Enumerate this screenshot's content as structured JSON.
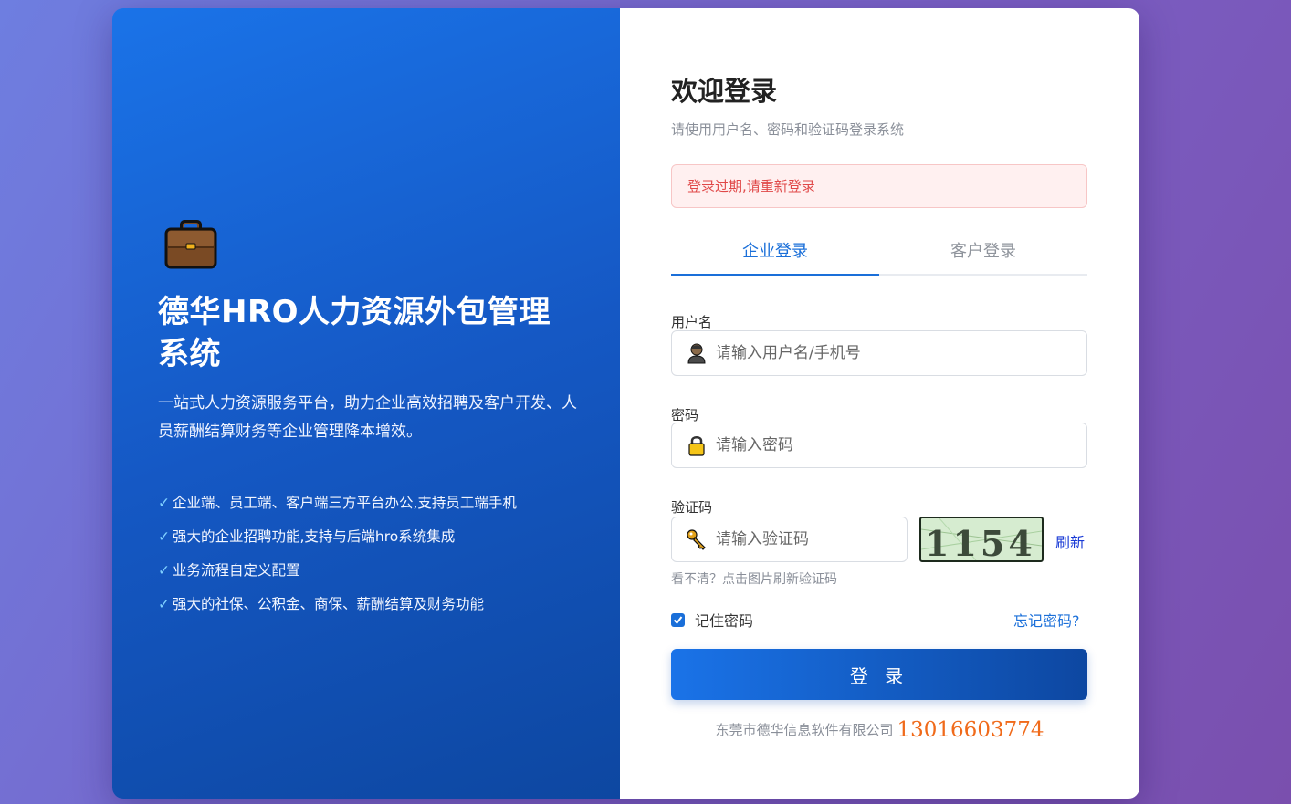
{
  "left": {
    "title": "德华HRO人力资源外包管理系统",
    "description": "一站式人力资源服务平台，助力企业高效招聘及客户开发、人员薪酬结算财务等企业管理降本增效。",
    "features": [
      "企业端、员工端、客户端三方平台办公,支持员工端手机",
      "强大的企业招聘功能,支持与后端hro系统集成",
      "业务流程自定义配置",
      "强大的社保、公积金、商保、薪酬结算及财务功能"
    ],
    "check_glyph": "✓",
    "icon": "briefcase-icon"
  },
  "login": {
    "title": "欢迎登录",
    "subtitle": "请使用用户名、密码和验证码登录系统",
    "alert": "登录过期,请重新登录",
    "tabs": [
      {
        "label": "企业登录",
        "active": true
      },
      {
        "label": "客户登录",
        "active": false
      }
    ],
    "username": {
      "label": "用户名",
      "placeholder": "请输入用户名/手机号",
      "value": ""
    },
    "password": {
      "label": "密码",
      "placeholder": "请输入密码",
      "value": ""
    },
    "captcha": {
      "label": "验证码",
      "placeholder": "请输入验证码",
      "value": "",
      "image_text": "1154",
      "refresh_label": "刷新",
      "hint": "看不清？点击图片刷新验证码"
    },
    "remember_label": "记住密码",
    "remember_checked": true,
    "forgot_label": "忘记密码?",
    "submit_label": "登 录"
  },
  "footer": {
    "company": "东莞市德华信息软件有限公司",
    "phone": "13016603774"
  },
  "colors": {
    "accent": "#1a6fd9",
    "alert_text": "#e04848",
    "phone": "#f06a1a"
  }
}
